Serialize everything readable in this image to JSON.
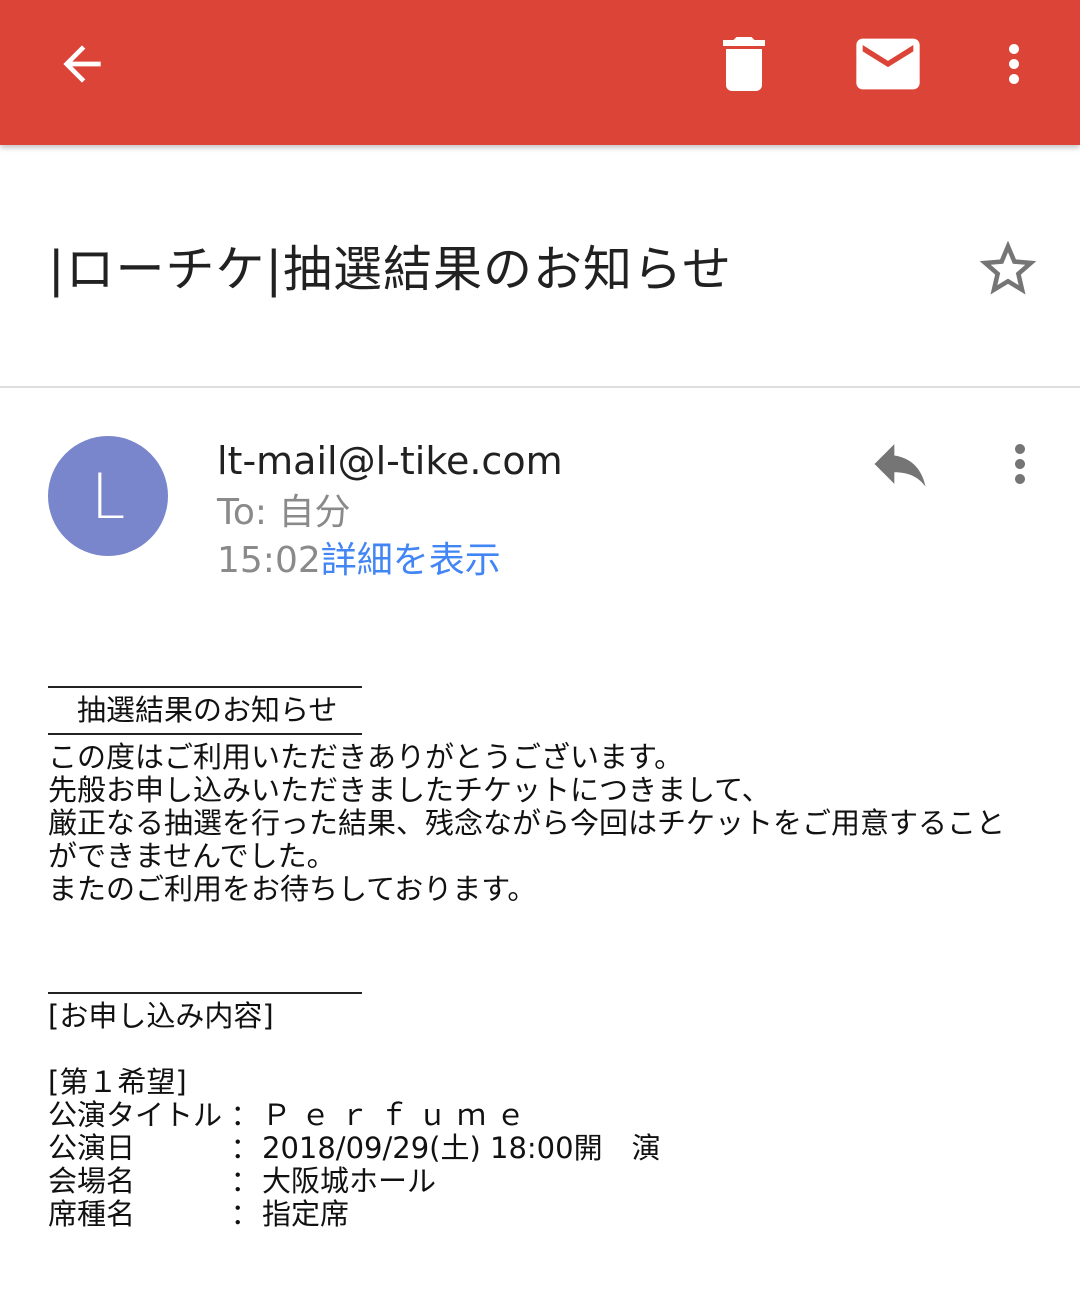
{
  "toolbar": {
    "background_color": "#db4437",
    "back_icon": "arrow-back-icon",
    "delete_icon": "trash-icon",
    "mail_icon": "mail-icon",
    "more_icon": "more-vert-icon"
  },
  "email": {
    "subject": "|ローチケ|抽選結果のお知らせ",
    "star_icon": "star-outline-icon",
    "sender": {
      "avatar_letter": "L",
      "avatar_color": "#7986cb",
      "address": "lt-mail@l-tike.com",
      "to_line": "To: 自分",
      "time": "15:02",
      "details_link": "詳細を表示",
      "reply_icon": "reply-icon",
      "more_icon": "more-vert-icon"
    },
    "body": {
      "heading": "　抽選結果のお知らせ",
      "paragraph": [
        "この度はご利用いただきありがとうございます。",
        "先般お申し込みいただきましたチケットにつきまして、",
        "厳正なる抽選を行った結果、残念ながら今回はチケットをご用意すること",
        "ができませんでした。",
        "またのご利用をお待ちしております。"
      ],
      "section_title": "[お申し込み内容]",
      "choice_title": "[第１希望]",
      "fields": [
        {
          "label": "公演タイトル",
          "sep": "：",
          "value": "Ｐｅｒｆｕｍｅ"
        },
        {
          "label": "公演日",
          "sep": "：",
          "value": "2018/09/29(土) 18:00開　演"
        },
        {
          "label": "会場名",
          "sep": "：",
          "value": "大阪城ホール"
        },
        {
          "label": "席種名",
          "sep": "：",
          "value": "指定席"
        }
      ]
    }
  }
}
